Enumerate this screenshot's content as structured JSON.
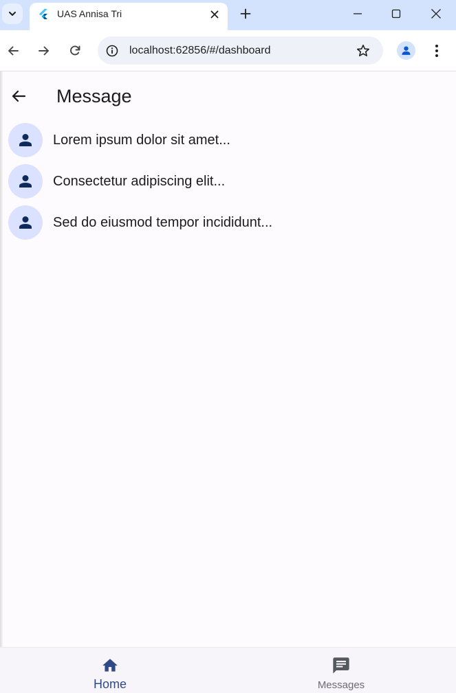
{
  "browser": {
    "tab_title": "UAS Annisa Tri",
    "url": "localhost:62856/#/dashboard"
  },
  "app_bar": {
    "title": "Message"
  },
  "messages": [
    {
      "text": "Lorem ipsum dolor sit amet...",
      "icon": "person-icon"
    },
    {
      "text": "Consectetur adipiscing elit...",
      "icon": "person-icon"
    },
    {
      "text": "Sed do eiusmod tempor incididunt...",
      "icon": "person-icon"
    }
  ],
  "bottom_nav": {
    "items": [
      {
        "label": "Home",
        "icon": "home-icon",
        "selected": true
      },
      {
        "label": "Messages",
        "icon": "chat-icon",
        "selected": false
      }
    ]
  },
  "colors": {
    "tabstrip": "#d3e3fd",
    "avatar_bg": "#dae2ff",
    "avatar_icon": "#0e2a5c",
    "nav_selected": "#2f4a86",
    "nav_unselected": "#6c6c73"
  }
}
